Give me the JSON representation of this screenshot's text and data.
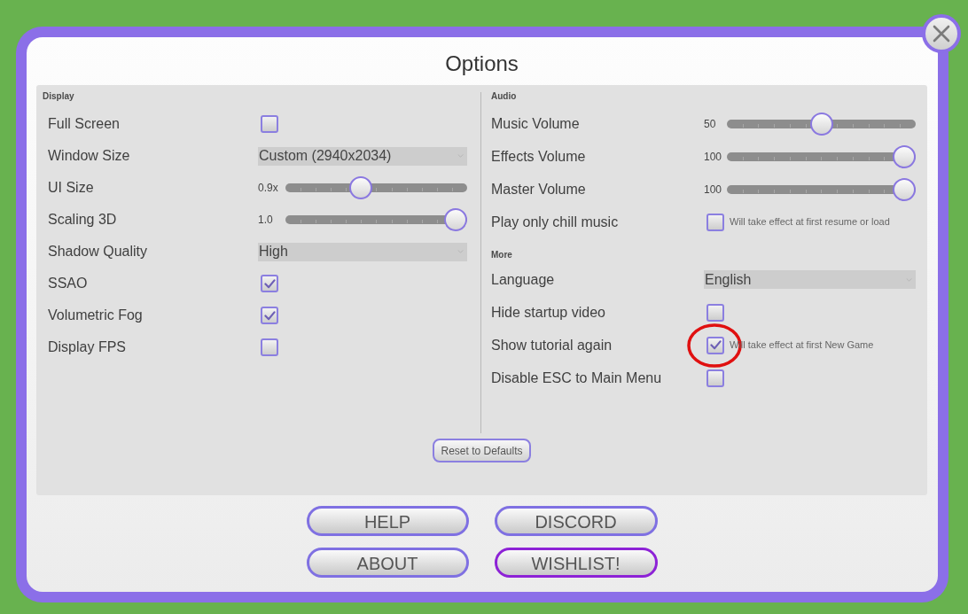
{
  "window": {
    "title": "Options"
  },
  "display": {
    "heading": "Display",
    "settings": [
      {
        "kind": "checkbox",
        "label": "Full Screen",
        "checked": false
      },
      {
        "kind": "dropdown",
        "label": "Window Size",
        "value": "Custom (2940x2034)"
      },
      {
        "kind": "slider",
        "label": "UI Size",
        "reading": "0.9x",
        "level": 0.4
      },
      {
        "kind": "slider",
        "label": "Scaling 3D",
        "reading": "1.0",
        "level": 1.0
      },
      {
        "kind": "dropdown",
        "label": "Shadow Quality",
        "value": "High"
      },
      {
        "kind": "checkbox",
        "label": "SSAO",
        "checked": true
      },
      {
        "kind": "checkbox",
        "label": "Volumetric Fog",
        "checked": true
      },
      {
        "kind": "checkbox",
        "label": "Display FPS",
        "checked": false
      }
    ]
  },
  "audio": {
    "heading": "Audio",
    "settings": [
      {
        "kind": "slider",
        "label": "Music Volume",
        "reading": "50",
        "level": 0.5
      },
      {
        "kind": "slider",
        "label": "Effects Volume",
        "reading": "100",
        "level": 1.0
      },
      {
        "kind": "slider",
        "label": "Master Volume",
        "reading": "100",
        "level": 1.0
      },
      {
        "kind": "checkbox",
        "label": "Play only chill music",
        "checked": false,
        "note": "Will take effect at first resume or load"
      }
    ]
  },
  "more": {
    "heading": "More",
    "settings": [
      {
        "kind": "dropdown",
        "label": "Language",
        "value": "English",
        "circled": false
      },
      {
        "kind": "checkbox",
        "label": "Hide startup video",
        "checked": false,
        "circled": false
      },
      {
        "kind": "checkbox",
        "label": "Show tutorial again",
        "checked": true,
        "note": "Will take effect at first New Game",
        "circled": true
      },
      {
        "kind": "checkbox",
        "label": "Disable ESC to Main Menu",
        "checked": false,
        "circled": false
      }
    ]
  },
  "reset_button": "Reset to Defaults",
  "buttons": [
    {
      "label": "HELP",
      "highlighted": false
    },
    {
      "label": "DISCORD",
      "highlighted": false
    },
    {
      "label": "ABOUT",
      "highlighted": false
    },
    {
      "label": "WISHLIST!",
      "highlighted": true
    }
  ]
}
